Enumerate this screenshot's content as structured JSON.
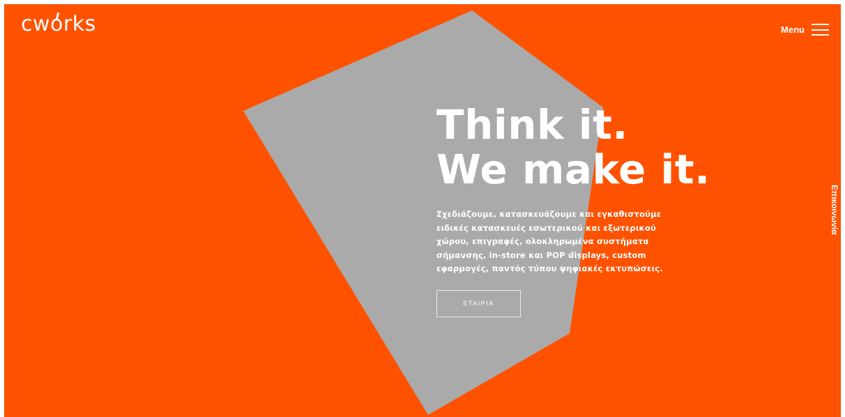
{
  "brand": {
    "logo_text": "cworks"
  },
  "header": {
    "menu_label": "Menu"
  },
  "hero": {
    "headline_line1": "Think it.",
    "headline_line2": "We make it.",
    "description": "Σχεδιάζουμε, κατασκευάζουμε και εγκαθιστούμε ειδικές κατασκευές εσωτερικού και εξωτερικού χώρου, επιγραφές, ολοκληρωμένα συστήματα σήμανσης, in-store και POP displays, custom εφαρμογές, παντός τύπου ψηφιακές εκτυπώσεις.",
    "button_label": "ΕΤΑΙΡΙΑ"
  },
  "sidebar": {
    "contact_label": "Επικοινωνία"
  },
  "colors": {
    "background": "#ff5200",
    "shape": "#aaaaaa",
    "text": "#ffffff"
  }
}
